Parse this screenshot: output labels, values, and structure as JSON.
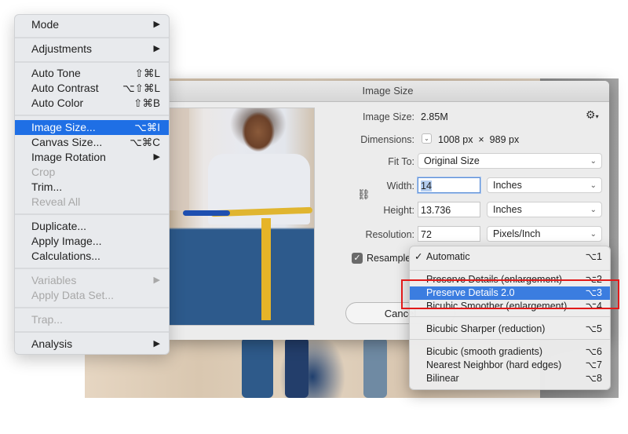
{
  "image_menu": {
    "items": [
      {
        "label": "Mode",
        "shortcut": "",
        "submenu": true,
        "enabled": true
      },
      {
        "label": "Adjustments",
        "shortcut": "",
        "submenu": true,
        "enabled": true
      },
      {
        "label": "Auto Tone",
        "shortcut": "⇧⌘L",
        "submenu": false,
        "enabled": true
      },
      {
        "label": "Auto Contrast",
        "shortcut": "⌥⇧⌘L",
        "submenu": false,
        "enabled": true
      },
      {
        "label": "Auto Color",
        "shortcut": "⇧⌘B",
        "submenu": false,
        "enabled": true
      },
      {
        "label": "Image Size...",
        "shortcut": "⌥⌘I",
        "submenu": false,
        "enabled": true,
        "highlighted": true
      },
      {
        "label": "Canvas Size...",
        "shortcut": "⌥⌘C",
        "submenu": false,
        "enabled": true
      },
      {
        "label": "Image Rotation",
        "shortcut": "",
        "submenu": true,
        "enabled": true
      },
      {
        "label": "Crop",
        "shortcut": "",
        "submenu": false,
        "enabled": false
      },
      {
        "label": "Trim...",
        "shortcut": "",
        "submenu": false,
        "enabled": true
      },
      {
        "label": "Reveal All",
        "shortcut": "",
        "submenu": false,
        "enabled": false
      },
      {
        "label": "Duplicate...",
        "shortcut": "",
        "submenu": false,
        "enabled": true
      },
      {
        "label": "Apply Image...",
        "shortcut": "",
        "submenu": false,
        "enabled": true
      },
      {
        "label": "Calculations...",
        "shortcut": "",
        "submenu": false,
        "enabled": true
      },
      {
        "label": "Variables",
        "shortcut": "",
        "submenu": true,
        "enabled": false
      },
      {
        "label": "Apply Data Set...",
        "shortcut": "",
        "submenu": false,
        "enabled": false
      },
      {
        "label": "Trap...",
        "shortcut": "",
        "submenu": false,
        "enabled": false
      },
      {
        "label": "Analysis",
        "shortcut": "",
        "submenu": true,
        "enabled": true
      }
    ],
    "submenu_arrow": "▶"
  },
  "dialog": {
    "title": "Image Size",
    "image_size_label": "Image Size:",
    "image_size_value": "2.85M",
    "dimensions_label": "Dimensions:",
    "dimensions_value": "1008 px  ×  989 px",
    "fit_to_label": "Fit To:",
    "fit_to_value": "Original Size",
    "width_label": "Width:",
    "width_value": "14",
    "width_unit": "Inches",
    "height_label": "Height:",
    "height_value": "13.736",
    "height_unit": "Inches",
    "resolution_label": "Resolution:",
    "resolution_value": "72",
    "resolution_unit": "Pixels/Inch",
    "resample_label": "Resample",
    "resample_checked": true,
    "cancel_label": "Cancel",
    "cancel_visible_text": "Can",
    "gear_icon": "⚙",
    "chevron": "⌄",
    "checkmark": "✓",
    "link_icon": "⛓"
  },
  "resample_menu": {
    "items": [
      {
        "label": "Automatic",
        "shortcut": "⌥1",
        "checked": true
      },
      {
        "label": "Preserve Details (enlargement)",
        "shortcut": "⌥2"
      },
      {
        "label": "Preserve Details 2.0",
        "shortcut": "⌥3",
        "highlighted": true
      },
      {
        "label": "Bicubic Smoother (enlargement)",
        "shortcut": "⌥4"
      },
      {
        "label": "Bicubic Sharper (reduction)",
        "shortcut": "⌥5"
      },
      {
        "label": "Bicubic (smooth gradients)",
        "shortcut": "⌥6"
      },
      {
        "label": "Nearest Neighbor (hard edges)",
        "shortcut": "⌥7"
      },
      {
        "label": "Bilinear",
        "shortcut": "⌥8"
      }
    ]
  },
  "colors": {
    "menu_highlight": "#1f6fe5",
    "dropdown_highlight": "#3b7de0",
    "annotation_box": "#e11a1a"
  }
}
